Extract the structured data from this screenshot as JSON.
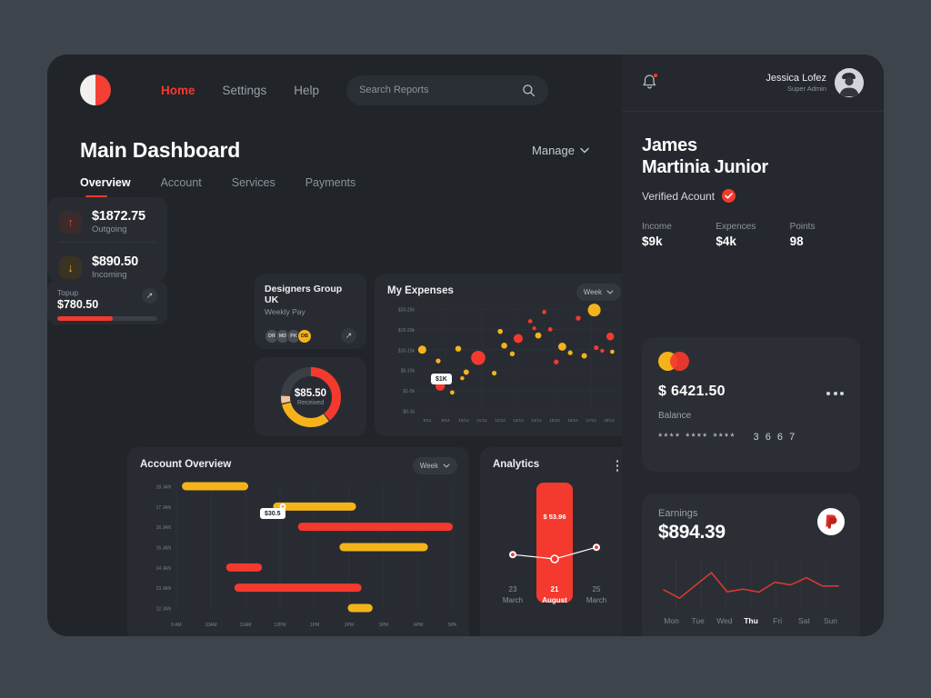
{
  "header": {
    "logo": "brand-logo",
    "nav": [
      {
        "label": "Home",
        "active": true
      },
      {
        "label": "Settings",
        "active": false
      },
      {
        "label": "Help",
        "active": false
      }
    ],
    "search": {
      "placeholder": "Search Reports",
      "value": "",
      "icon": "search-icon"
    }
  },
  "page": {
    "title": "Main Dashboard",
    "manage_label": "Manage",
    "tabs": [
      {
        "label": "Overview",
        "active": true
      },
      {
        "label": "Account",
        "active": false
      },
      {
        "label": "Services",
        "active": false
      },
      {
        "label": "Payments",
        "active": false
      }
    ]
  },
  "stats": {
    "outgoing": {
      "value": "$1872.75",
      "label": "Outgoing",
      "icon": "arrow-up-icon",
      "color": "#f4392e"
    },
    "incoming": {
      "value": "$890.50",
      "label": "Incoming",
      "icon": "arrow-down-icon",
      "color": "#f5b31b"
    }
  },
  "topup": {
    "label": "Topup",
    "value": "$780.50",
    "progress_percent": 55,
    "action_icon": "arrow-up-right-icon"
  },
  "group": {
    "title": "Designers Group UK",
    "subtitle": "Weekly Pay",
    "members": [
      {
        "initials": "DR",
        "highlighted": false
      },
      {
        "initials": "MD",
        "highlighted": false
      },
      {
        "initials": "PK",
        "highlighted": false
      },
      {
        "initials": "DB",
        "highlighted": true
      }
    ],
    "action_icon": "arrow-up-right-icon"
  },
  "donut": {
    "value": "$85.50",
    "label": "Received",
    "segments": [
      {
        "name": "red",
        "color": "#f4392e",
        "percent": 39
      },
      {
        "name": "yellow",
        "color": "#f5b31b",
        "percent": 31
      },
      {
        "name": "peach",
        "color": "#f8c39a",
        "percent": 4
      },
      {
        "name": "track",
        "color": "#3a3f46",
        "percent": 26
      }
    ]
  },
  "expenses": {
    "title": "My Expenses",
    "range_label": "Week",
    "tooltip": "$1K",
    "chart_data": {
      "type": "scatter",
      "title": "My Expenses",
      "xlabel": "",
      "ylabel": "",
      "grid": true,
      "legend": "none",
      "ytick_labels": [
        "$20-25k",
        "$15-20k",
        "$10-15k",
        "$5-10k",
        "$1-5k",
        "$0-1k"
      ],
      "xtick_labels": [
        "8/12",
        "9/12",
        "10/12",
        "11/12",
        "12/12",
        "13/12",
        "14/12",
        "15/12",
        "16/12",
        "17/12",
        "18/12"
      ],
      "series": [
        {
          "name": "expense-bubbles",
          "points": [
            {
              "x": 0.02,
              "y": 3.0,
              "r": 4.5,
              "color": "#f5b31b"
            },
            {
              "x": 0.1,
              "y": 2.45,
              "r": 2.6,
              "color": "#f5b31b"
            },
            {
              "x": 0.11,
              "y": 1.22,
              "r": 5.2,
              "color": "#f4392e"
            },
            {
              "x": 0.17,
              "y": 0.9,
              "r": 2.4,
              "color": "#f5b31b"
            },
            {
              "x": 0.2,
              "y": 3.05,
              "r": 3.2,
              "color": "#f5b31b"
            },
            {
              "x": 0.22,
              "y": 1.6,
              "r": 2.2,
              "color": "#f5b31b"
            },
            {
              "x": 0.24,
              "y": 1.9,
              "r": 3.0,
              "color": "#f5b31b"
            },
            {
              "x": 0.3,
              "y": 2.6,
              "r": 7.8,
              "color": "#f4392e"
            },
            {
              "x": 0.38,
              "y": 1.85,
              "r": 2.6,
              "color": "#f5b31b"
            },
            {
              "x": 0.41,
              "y": 3.9,
              "r": 2.8,
              "color": "#f5b31b"
            },
            {
              "x": 0.43,
              "y": 3.2,
              "r": 3.3,
              "color": "#f5b31b"
            },
            {
              "x": 0.47,
              "y": 2.8,
              "r": 2.7,
              "color": "#f5b31b"
            },
            {
              "x": 0.5,
              "y": 3.55,
              "r": 5.0,
              "color": "#f4392e"
            },
            {
              "x": 0.56,
              "y": 4.4,
              "r": 2.3,
              "color": "#f4392e"
            },
            {
              "x": 0.58,
              "y": 4.05,
              "r": 2.1,
              "color": "#f4392e"
            },
            {
              "x": 0.6,
              "y": 3.7,
              "r": 3.4,
              "color": "#f5b31b"
            },
            {
              "x": 0.63,
              "y": 4.85,
              "r": 2.3,
              "color": "#f4392e"
            },
            {
              "x": 0.66,
              "y": 4.0,
              "r": 2.4,
              "color": "#f4392e"
            },
            {
              "x": 0.69,
              "y": 2.4,
              "r": 2.7,
              "color": "#f4392e"
            },
            {
              "x": 0.72,
              "y": 3.15,
              "r": 4.4,
              "color": "#f5b31b"
            },
            {
              "x": 0.76,
              "y": 2.85,
              "r": 2.6,
              "color": "#f5b31b"
            },
            {
              "x": 0.8,
              "y": 4.55,
              "r": 2.7,
              "color": "#f4392e"
            },
            {
              "x": 0.83,
              "y": 2.7,
              "r": 3.0,
              "color": "#f5b31b"
            },
            {
              "x": 0.88,
              "y": 4.95,
              "r": 7.0,
              "color": "#f5b31b"
            },
            {
              "x": 0.89,
              "y": 3.1,
              "r": 2.6,
              "color": "#f4392e"
            },
            {
              "x": 0.92,
              "y": 2.95,
              "r": 2.2,
              "color": "#f4392e"
            },
            {
              "x": 0.96,
              "y": 3.65,
              "r": 4.2,
              "color": "#f4392e"
            },
            {
              "x": 0.97,
              "y": 2.9,
              "r": 2.3,
              "color": "#f5b31b"
            }
          ]
        }
      ]
    }
  },
  "account_overview": {
    "title": "Account Overview",
    "range_label": "Week",
    "tooltip": "$30.5",
    "chart_data": {
      "type": "bar",
      "title": "Account Overview",
      "orientation": "horizontal-gantt",
      "ytick_labels": [
        "18 JAN",
        "17 JAN",
        "16 JAN",
        "15 JAN",
        "14 JAN",
        "13 JAN",
        "12 JAN"
      ],
      "xtick_labels": [
        "9 AM",
        "10AM",
        "11AM",
        "12PM",
        "1PM",
        "2PM",
        "3PM",
        "4PM",
        "5PM"
      ],
      "bars": [
        {
          "row": "18 JAN",
          "start": 0.02,
          "end": 0.26,
          "color": "#f5b31b"
        },
        {
          "row": "17 JAN",
          "start": 0.35,
          "end": 0.65,
          "color": "#f5b31b"
        },
        {
          "row": "16 JAN",
          "start": 0.44,
          "end": 1.0,
          "color": "#f4392e"
        },
        {
          "row": "15 JAN",
          "start": 0.59,
          "end": 0.91,
          "color": "#f5b31b"
        },
        {
          "row": "14 JAN",
          "start": 0.18,
          "end": 0.31,
          "color": "#f4392e"
        },
        {
          "row": "13 JAN",
          "start": 0.21,
          "end": 0.67,
          "color": "#f4392e"
        },
        {
          "row": "12 JAN",
          "start": 0.62,
          "end": 0.71,
          "color": "#f5b31b"
        }
      ]
    }
  },
  "analytics": {
    "title": "Analytics",
    "menu_icon": "more-vertical-icon",
    "chart_data": {
      "type": "line",
      "title": "Analytics",
      "highlight_value": "$ 53.96",
      "categories": [
        "23 March",
        "21 August",
        "25 March"
      ],
      "labels_top": [
        "23",
        "21",
        "25"
      ],
      "labels_bottom": [
        "March",
        "August",
        "March"
      ],
      "highlight_index": 1,
      "values": [
        0.52,
        0.4,
        0.72
      ]
    }
  },
  "sidebar": {
    "notification": {
      "icon": "bell-icon",
      "has_badge": true
    },
    "account_user": {
      "name": "Jessica Lofez",
      "role": "Super Admin",
      "avatar": "user-avatar"
    },
    "profile": {
      "name_line1": "James",
      "name_line2": "Martinia Junior",
      "verified_label": "Verified Acount",
      "verified_icon": "check-circle-icon"
    },
    "kpis": [
      {
        "label": "Income",
        "value": "$9k"
      },
      {
        "label": "Expences",
        "value": "$4k"
      },
      {
        "label": "Points",
        "value": "98"
      }
    ],
    "balance_card": {
      "brand_icon": "mastercard-icon",
      "amount": "$ 6421.50",
      "label": "Balance",
      "masked_number": "****   ****   ****",
      "last_four": "3 6 6 7",
      "menu_icon": "more-horizontal-icon"
    },
    "earnings_card": {
      "label": "Earnings",
      "value": "$894.39",
      "brand_icon": "paypal-icon",
      "chart_data": {
        "type": "line",
        "title": "Earnings",
        "categories": [
          "Mon",
          "Tue",
          "Wed",
          "Thu",
          "Fri",
          "Sat",
          "Sun"
        ],
        "values": [
          0.5,
          0.28,
          0.62,
          0.95,
          0.45,
          0.52,
          0.44,
          0.7,
          0.63,
          0.82,
          0.6,
          0.6
        ],
        "active_category": "Thu",
        "line_color": "#e03a30"
      }
    }
  },
  "colors": {
    "bg_outer": "#3e444c",
    "bg_app": "#212429",
    "card": "#282c32",
    "side": "#25282e",
    "side_card": "#2b2f35",
    "accent_red": "#f4392e",
    "accent_yellow": "#f5b31b",
    "text": "#ffffff",
    "muted": "#8e949c"
  }
}
